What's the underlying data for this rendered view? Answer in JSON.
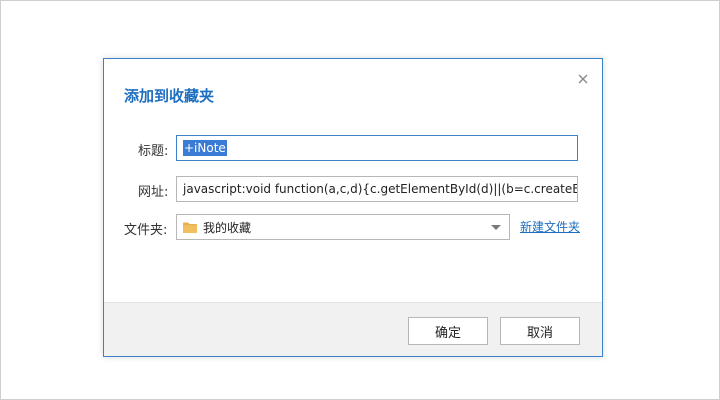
{
  "dialog": {
    "title": "添加到收藏夹",
    "close_icon": "close-icon"
  },
  "form": {
    "title_label": "标题:",
    "title_value": "+iNote",
    "url_label": "网址:",
    "url_value": "javascript:void function(a,c,d){c.getElementById(d)||(b=c.createElement('s",
    "folder_label": "文件夹:",
    "folder_value": "我的收藏",
    "folder_icon": "folder-icon",
    "new_folder_link": "新建文件夹"
  },
  "buttons": {
    "ok": "确定",
    "cancel": "取消"
  },
  "colors": {
    "accent": "#1f6fc0",
    "selection": "#3a7bd5",
    "folder": "#e8b04a"
  }
}
